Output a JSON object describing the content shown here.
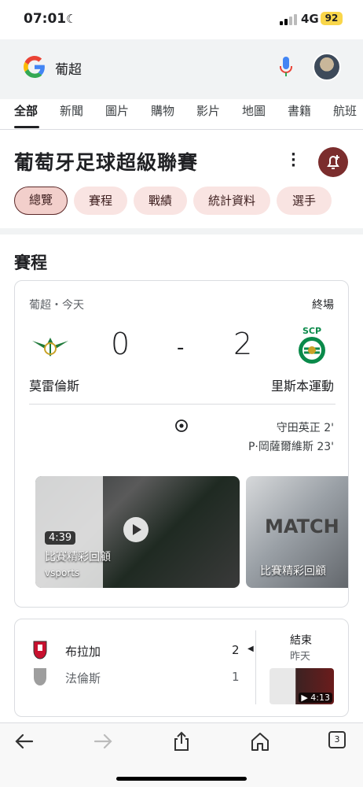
{
  "status_bar": {
    "time": "07:01",
    "network": "4G",
    "battery": "92"
  },
  "search": {
    "query": "葡超"
  },
  "tabs": [
    "全部",
    "新聞",
    "圖片",
    "購物",
    "影片",
    "地圖",
    "書籍",
    "航班"
  ],
  "header": {
    "title": "葡萄牙足球超級聯賽",
    "chips": [
      "總覽",
      "賽程",
      "戰績",
      "統計資料",
      "選手"
    ]
  },
  "schedule": {
    "heading": "賽程",
    "match1": {
      "league_date": "葡超・今天",
      "status": "終場",
      "home_team": "莫雷倫斯",
      "away_team": "里斯本運動",
      "home_score": "0",
      "away_score": "2",
      "dash": "-",
      "scorers": [
        "守田英正 2'",
        "P·岡薩爾維斯 23'"
      ],
      "videos": [
        {
          "duration": "4:39",
          "title": "比賽精彩回顧",
          "source": "vsports"
        },
        {
          "title": "比賽精彩回顧"
        }
      ]
    },
    "match2": {
      "team1": "布拉加",
      "team2": "法倫斯",
      "score1": "2",
      "score2": "1",
      "status": "結束",
      "date": "昨天",
      "video_duration": "4:13"
    }
  },
  "toolbar": {
    "tab_count": "3"
  },
  "colors": {
    "accent": "#7b2d2d",
    "chip_bg": "#f9e4e2",
    "sporting_green": "#0a8a4a"
  }
}
